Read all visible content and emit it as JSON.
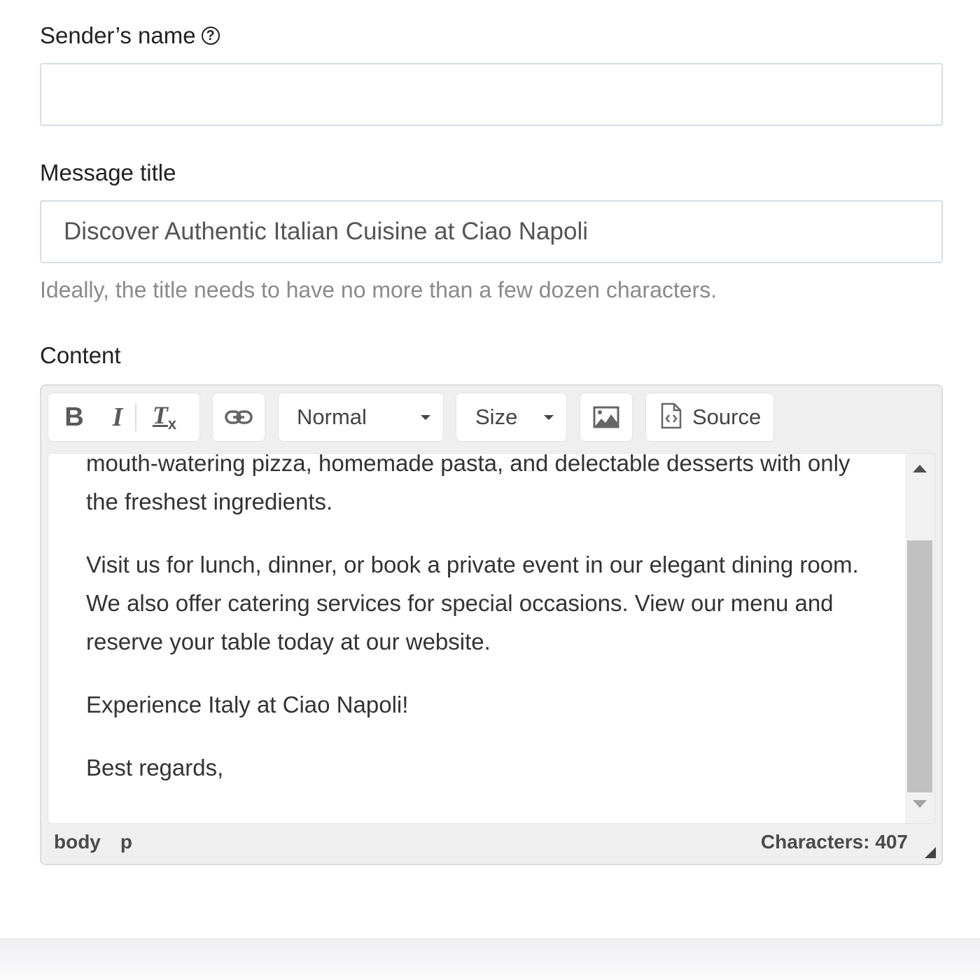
{
  "sender": {
    "label": "Sender’s name",
    "help_icon": "question-circle-icon",
    "help_glyph": "?",
    "value": "",
    "placeholder": ""
  },
  "message_title": {
    "label": "Message title",
    "value": "Discover Authentic Italian Cuisine at Ciao Napoli",
    "hint": "Ideally, the title needs to have no more than a few dozen characters."
  },
  "content": {
    "label": "Content",
    "toolbar": {
      "bold": "B",
      "italic": "I",
      "remove_format": "T",
      "remove_format_sub": "x",
      "link_icon": "link-icon",
      "format_combo": "Normal",
      "size_combo": "Size",
      "image_icon": "image-icon",
      "source_label": "Source",
      "source_icon": "source-document-icon"
    },
    "paragraphs": [
      "mouth-watering pizza, homemade pasta, and delectable desserts with only the freshest ingredients.",
      "Visit us for lunch, dinner, or book a private event in our elegant dining room. We also offer catering services for special occasions. View our menu and reserve your table today at our website.",
      "Experience Italy at Ciao Napoli!",
      "Best regards,"
    ],
    "elements_path": [
      "body",
      "p"
    ],
    "char_count_label": "Characters: 407"
  }
}
